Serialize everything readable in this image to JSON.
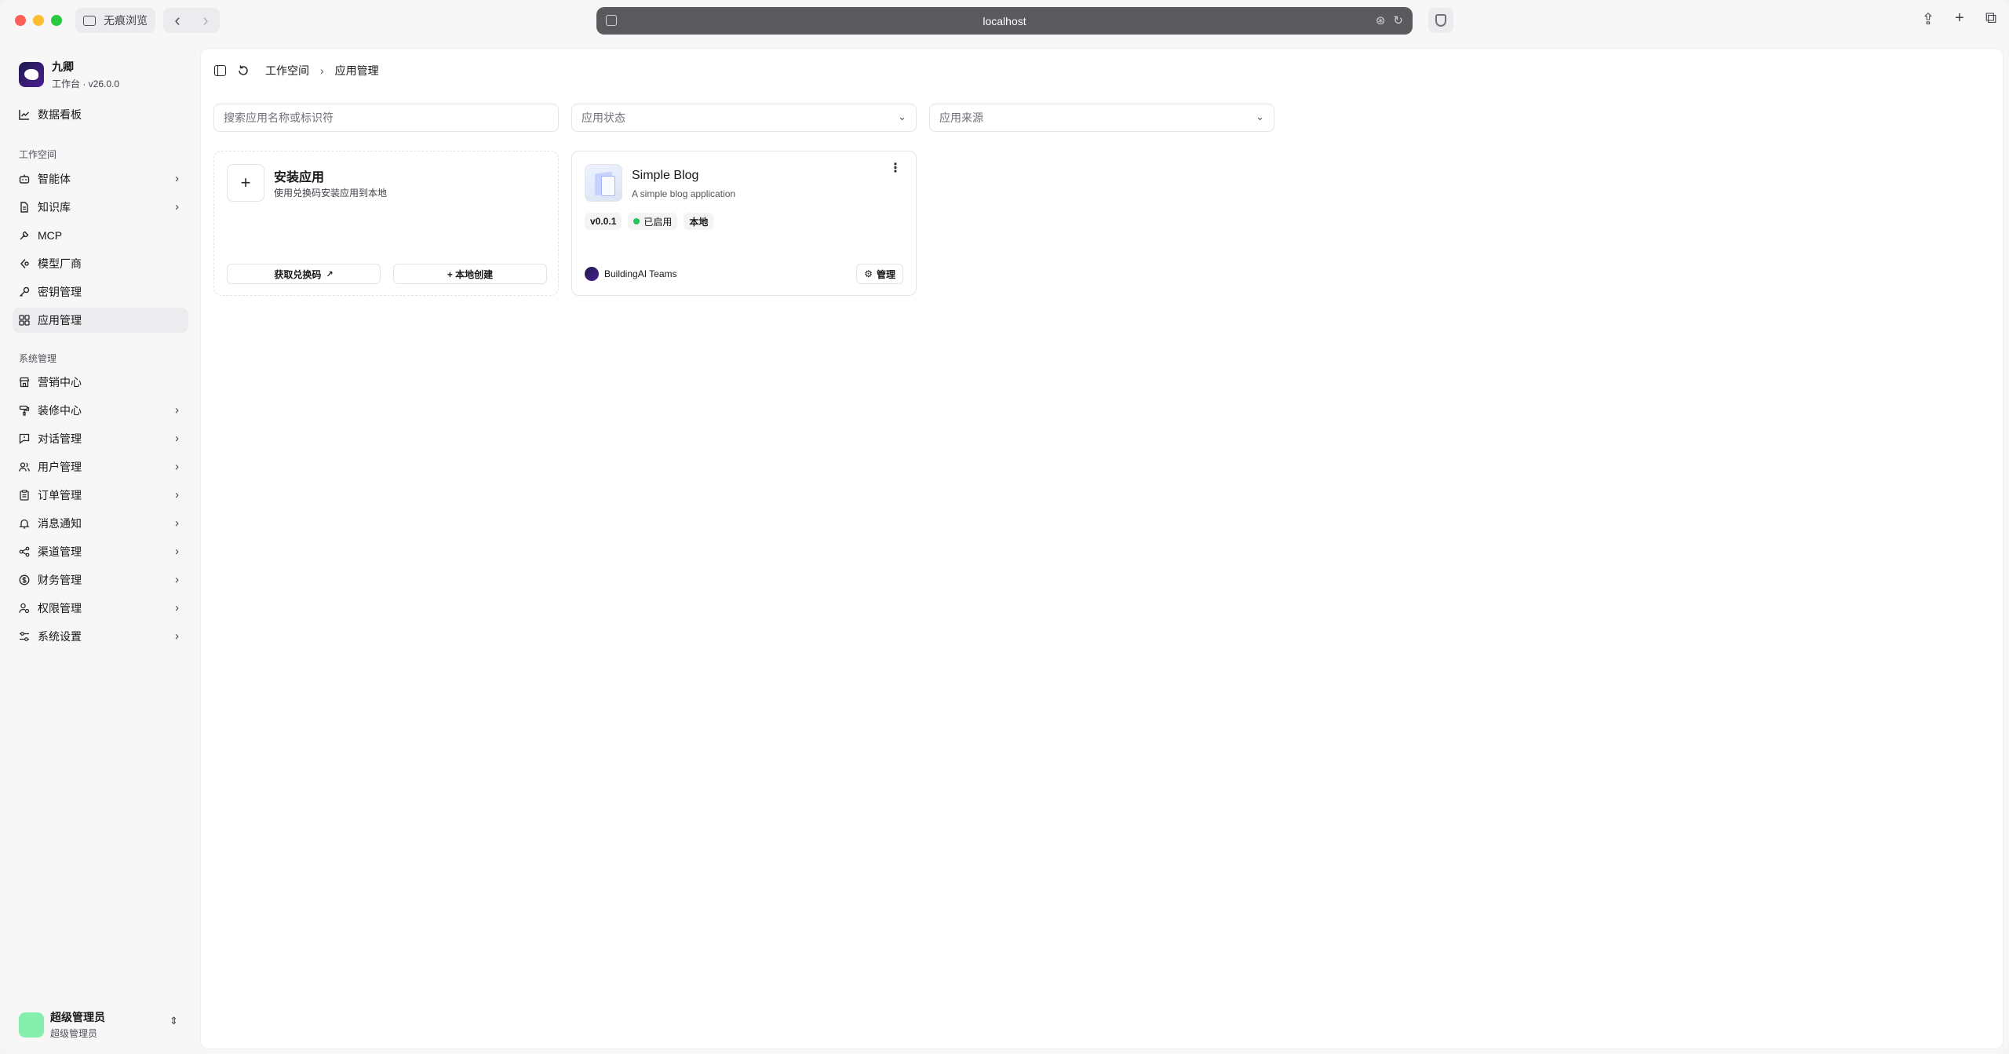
{
  "browser": {
    "private_label": "无痕浏览",
    "url": "localhost"
  },
  "brand": {
    "name": "九卿",
    "subtitle": "工作台 · v26.0.0"
  },
  "sidebar": {
    "dashboard": "数据看板",
    "workspace_label": "工作空间",
    "workspace_items": [
      {
        "label": "智能体",
        "has_children": true
      },
      {
        "label": "知识库",
        "has_children": true
      },
      {
        "label": "MCP",
        "has_children": false
      },
      {
        "label": "模型厂商",
        "has_children": false
      },
      {
        "label": "密钥管理",
        "has_children": false
      },
      {
        "label": "应用管理",
        "has_children": false,
        "active": true
      }
    ],
    "system_label": "系统管理",
    "system_items": [
      {
        "label": "营销中心",
        "has_children": false
      },
      {
        "label": "装修中心",
        "has_children": true
      },
      {
        "label": "对话管理",
        "has_children": true
      },
      {
        "label": "用户管理",
        "has_children": true
      },
      {
        "label": "订单管理",
        "has_children": true
      },
      {
        "label": "消息通知",
        "has_children": true
      },
      {
        "label": "渠道管理",
        "has_children": true
      },
      {
        "label": "财务管理",
        "has_children": true
      },
      {
        "label": "权限管理",
        "has_children": true
      },
      {
        "label": "系统设置",
        "has_children": true
      }
    ]
  },
  "user": {
    "name": "超级管理员",
    "role": "超级管理员"
  },
  "breadcrumb": {
    "parent": "工作空间",
    "current": "应用管理"
  },
  "filters": {
    "search_placeholder": "搜索应用名称或标识符",
    "status_placeholder": "应用状态",
    "source_placeholder": "应用来源"
  },
  "install_card": {
    "title": "安装应用",
    "description": "使用兑换码安装应用到本地",
    "redeem_button": "获取兑换码",
    "local_create_button": "+ 本地创建"
  },
  "apps": [
    {
      "name": "Simple Blog",
      "description": "A simple blog application",
      "version": "v0.0.1",
      "status": "已启用",
      "source": "本地",
      "author": "BuildingAI Teams",
      "manage_label": "管理",
      "status_color": "#22c55e"
    }
  ]
}
